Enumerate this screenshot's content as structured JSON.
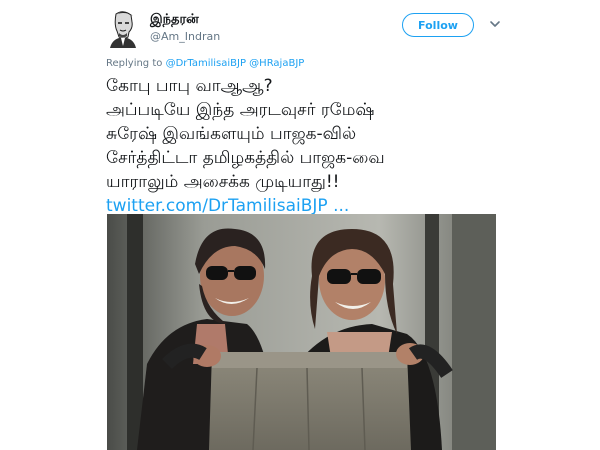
{
  "tweet": {
    "display_name": "இந்தரன்",
    "handle": "@Am_Indran",
    "follow_label": "Follow",
    "reply_prefix": "Replying to",
    "reply_mentions": "@DrTamilisaiBJP @HRajaBJP",
    "lines": [
      "கோபு பாபு வாஆஆ?",
      "அப்படியே இந்த அரடவுசர் ரமேஷ்",
      "சுரேஷ் இவங்களயும் பாஜக-வில்",
      "சேர்த்திட்டா தமிழகத்தில் பாஜக-வை",
      "யாராலும் அசைக்க முடியாது!!"
    ],
    "link_text": "twitter.com/DrTamilisaiBJP ..."
  },
  "icons": {
    "avatar": "avatar-portrait-sketch",
    "more": "chevron-down-icon"
  },
  "colors": {
    "accent": "#1da1f2",
    "secondary_text": "#657786",
    "primary_text": "#14171a"
  }
}
